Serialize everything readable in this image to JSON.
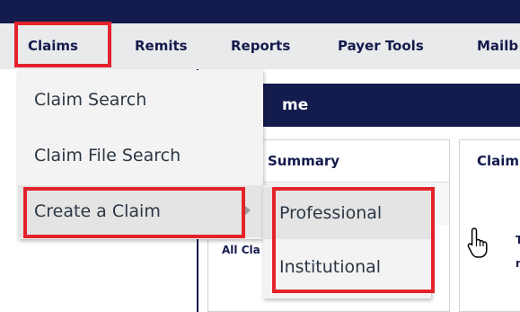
{
  "nav": {
    "items": [
      {
        "label": "Claims"
      },
      {
        "label": "Remits"
      },
      {
        "label": "Reports"
      },
      {
        "label": "Payer Tools"
      },
      {
        "label": "Mailb"
      }
    ]
  },
  "page": {
    "title_partial": "me",
    "summary_header": "Summary",
    "claims_header_partial": "Claim",
    "all_claims_partial": "All Cla",
    "link_partial_1": "T",
    "link_partial_2": "ni"
  },
  "menu": {
    "items": [
      {
        "label": "Claim Search"
      },
      {
        "label": "Claim File Search"
      },
      {
        "label": "Create a Claim",
        "has_submenu": true
      }
    ]
  },
  "submenu": {
    "items": [
      {
        "label": "Professional"
      },
      {
        "label": "Institutional"
      }
    ]
  },
  "colors": {
    "navy": "#141b4d",
    "highlight": "#e4222b",
    "menu_bg": "#f3f3f3"
  },
  "icons": {
    "submenu_arrow": "chevron-right-icon",
    "cursor": "hand-pointer-cursor-icon"
  }
}
